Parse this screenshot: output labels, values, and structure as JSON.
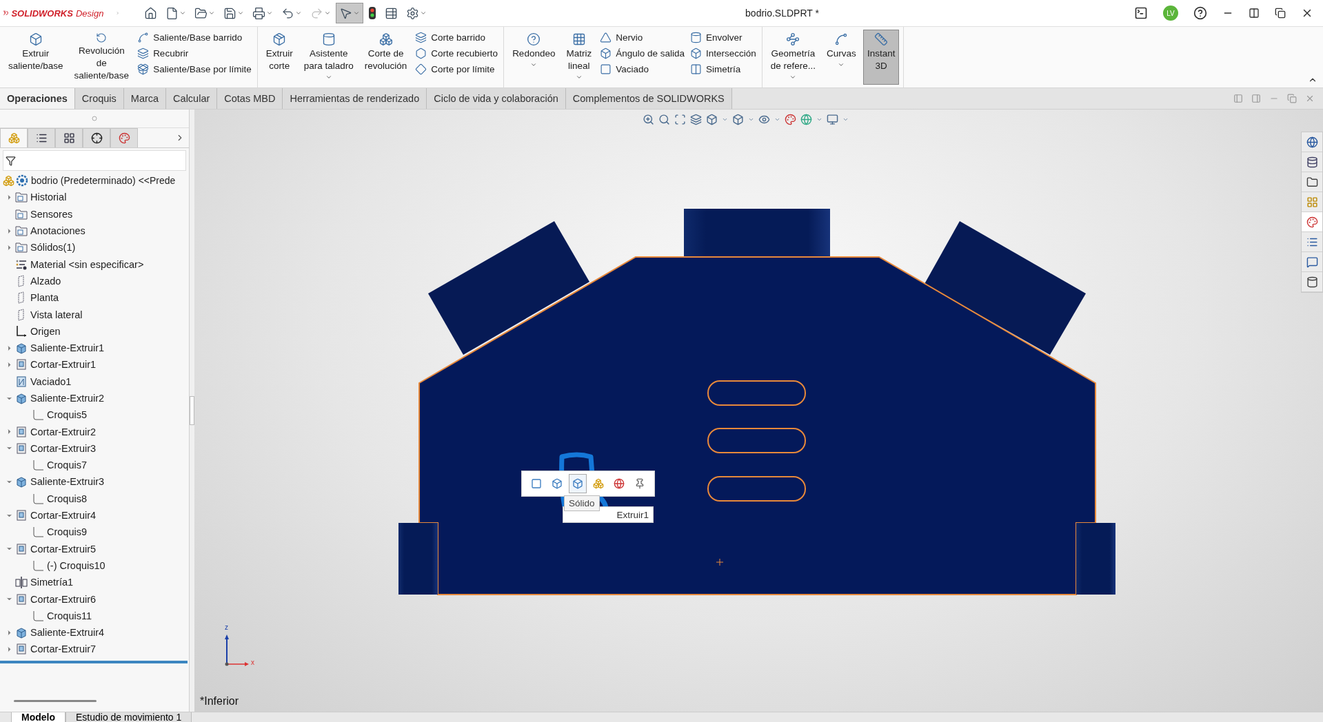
{
  "app": {
    "brand": "SOLIDWORKS",
    "product": "Design",
    "title": "bodrio.SLDPRT *",
    "user_initials": "LV"
  },
  "quick_access": [
    {
      "kind": "home",
      "dropdown": false,
      "selected": false
    },
    {
      "kind": "new",
      "dropdown": true,
      "selected": false
    },
    {
      "kind": "open",
      "dropdown": true,
      "selected": false
    },
    {
      "kind": "save",
      "dropdown": true,
      "selected": false
    },
    {
      "kind": "print",
      "dropdown": true,
      "selected": false
    },
    {
      "kind": "undo",
      "dropdown": true,
      "selected": false
    },
    {
      "kind": "redo",
      "dropdown": true,
      "selected": false
    },
    {
      "kind": "select",
      "dropdown": true,
      "selected": true
    },
    {
      "kind": "rebuild",
      "dropdown": false,
      "selected": false
    },
    {
      "kind": "properties",
      "dropdown": false,
      "selected": false
    },
    {
      "kind": "options",
      "dropdown": true,
      "selected": false
    }
  ],
  "ribbon": {
    "groups": [
      {
        "items": [
          {
            "kind": "large",
            "label": "Extruir\nsaliente/base",
            "dropdown": false,
            "selected": false
          },
          {
            "kind": "large",
            "label": "Revolución\nde\nsaliente/base",
            "dropdown": false,
            "selected": false
          },
          {
            "kind": "stack",
            "items": [
              {
                "label": "Saliente/Base barrido"
              },
              {
                "label": "Recubrir"
              },
              {
                "label": "Saliente/Base por límite"
              }
            ]
          }
        ]
      },
      {
        "items": [
          {
            "kind": "large",
            "label": "Extruir\ncorte",
            "dropdown": false,
            "selected": false
          },
          {
            "kind": "large",
            "label": "Asistente\npara taladro",
            "dropdown": true,
            "selected": false
          },
          {
            "kind": "large",
            "label": "Corte de\nrevolución",
            "dropdown": false,
            "selected": false
          },
          {
            "kind": "stack",
            "items": [
              {
                "label": "Corte barrido"
              },
              {
                "label": "Corte recubierto"
              },
              {
                "label": "Corte por límite"
              }
            ]
          }
        ]
      },
      {
        "items": [
          {
            "kind": "large",
            "label": "Redondeo",
            "dropdown": true,
            "selected": false
          },
          {
            "kind": "large",
            "label": "Matriz\nlineal",
            "dropdown": true,
            "selected": false
          },
          {
            "kind": "stack",
            "items": [
              {
                "label": "Nervio"
              },
              {
                "label": "Ángulo de salida"
              },
              {
                "label": "Vaciado"
              }
            ]
          },
          {
            "kind": "stack",
            "items": [
              {
                "label": "Envolver"
              },
              {
                "label": "Intersección"
              },
              {
                "label": "Simetría"
              }
            ]
          }
        ]
      },
      {
        "items": [
          {
            "kind": "large",
            "label": "Geometría\nde refere...",
            "dropdown": true,
            "selected": false
          },
          {
            "kind": "large",
            "label": "Curvas",
            "dropdown": true,
            "selected": false
          },
          {
            "kind": "large",
            "label": "Instant\n3D",
            "dropdown": false,
            "selected": true
          }
        ]
      }
    ]
  },
  "command_tabs": [
    {
      "label": "Operaciones",
      "selected": true
    },
    {
      "label": "Croquis",
      "selected": false
    },
    {
      "label": "Marca",
      "selected": false
    },
    {
      "label": "Calcular",
      "selected": false
    },
    {
      "label": "Cotas MBD",
      "selected": false
    },
    {
      "label": "Herramientas de renderizado",
      "selected": false
    },
    {
      "label": "Ciclo de vida y colaboración",
      "selected": false
    },
    {
      "label": "Complementos de SOLIDWORKS",
      "selected": false
    }
  ],
  "panel_tabs": [
    {
      "kind": "feature-manager",
      "selected": true
    },
    {
      "kind": "property-manager",
      "selected": false
    },
    {
      "kind": "configuration-manager",
      "selected": false
    },
    {
      "kind": "dimxpert",
      "selected": false
    },
    {
      "kind": "display-manager",
      "selected": false
    }
  ],
  "tree": {
    "root": {
      "label": "bodrio (Predeterminado) <<Prede"
    },
    "items": [
      {
        "label": "Historial",
        "kind": "history",
        "expandable": true,
        "expanded": false
      },
      {
        "label": "Sensores",
        "kind": "sensors",
        "expandable": false,
        "expanded": false
      },
      {
        "label": "Anotaciones",
        "kind": "annotations",
        "expandable": true,
        "expanded": false
      },
      {
        "label": "Sólidos(1)",
        "kind": "solids",
        "expandable": true,
        "expanded": false
      },
      {
        "label": "Material <sin especificar>",
        "kind": "material",
        "expandable": false,
        "expanded": false
      },
      {
        "label": "Alzado",
        "kind": "plane",
        "expandable": false,
        "expanded": false
      },
      {
        "label": "Planta",
        "kind": "plane",
        "expandable": false,
        "expanded": false
      },
      {
        "label": "Vista lateral",
        "kind": "plane",
        "expandable": false,
        "expanded": false
      },
      {
        "label": "Origen",
        "kind": "origin",
        "expandable": false,
        "expanded": false
      },
      {
        "label": "Saliente-Extruir1",
        "kind": "boss",
        "expandable": true,
        "expanded": false
      },
      {
        "label": "Cortar-Extruir1",
        "kind": "cut",
        "expandable": true,
        "expanded": false
      },
      {
        "label": "Vaciado1",
        "kind": "shell",
        "expandable": false,
        "expanded": false
      },
      {
        "label": "Saliente-Extruir2",
        "kind": "boss",
        "expandable": true,
        "expanded": true,
        "children": [
          {
            "label": "Croquis5",
            "kind": "sketch",
            "expandable": false,
            "expanded": false
          }
        ]
      },
      {
        "label": "Cortar-Extruir2",
        "kind": "cut",
        "expandable": true,
        "expanded": false
      },
      {
        "label": "Cortar-Extruir3",
        "kind": "cut",
        "expandable": true,
        "expanded": true,
        "children": [
          {
            "label": "Croquis7",
            "kind": "sketch",
            "expandable": false,
            "expanded": false
          }
        ]
      },
      {
        "label": "Saliente-Extruir3",
        "kind": "boss",
        "expandable": true,
        "expanded": true,
        "children": [
          {
            "label": "Croquis8",
            "kind": "sketch",
            "expandable": false,
            "expanded": false
          }
        ]
      },
      {
        "label": "Cortar-Extruir4",
        "kind": "cut",
        "expandable": true,
        "expanded": true,
        "children": [
          {
            "label": "Croquis9",
            "kind": "sketch",
            "expandable": false,
            "expanded": false
          }
        ]
      },
      {
        "label": "Cortar-Extruir5",
        "kind": "cut",
        "expandable": true,
        "expanded": true,
        "children": [
          {
            "label": "(-) Croquis10",
            "kind": "sketch",
            "expandable": false,
            "expanded": false
          }
        ]
      },
      {
        "label": "Simetría1",
        "kind": "mirror",
        "expandable": false,
        "expanded": false
      },
      {
        "label": "Cortar-Extruir6",
        "kind": "cut",
        "expandable": true,
        "expanded": true,
        "children": [
          {
            "label": "Croquis11",
            "kind": "sketch",
            "expandable": false,
            "expanded": false
          }
        ]
      },
      {
        "label": "Saliente-Extruir4",
        "kind": "boss",
        "expandable": true,
        "expanded": false
      },
      {
        "label": "Cortar-Extruir7",
        "kind": "cut",
        "expandable": true,
        "expanded": false
      }
    ]
  },
  "viewport": {
    "view_label": "*Inferior",
    "triad": {
      "vertical_label": "z",
      "horizontal_label": "x"
    },
    "context_toolbar": [
      {
        "kind": "face",
        "selected": false
      },
      {
        "kind": "feature",
        "selected": false
      },
      {
        "kind": "solid",
        "selected": true
      },
      {
        "kind": "part",
        "selected": false
      },
      {
        "kind": "appearance",
        "selected": false
      },
      {
        "kind": "pin",
        "selected": false
      }
    ],
    "hover_tooltip": "Sólido",
    "feature_tooltip": "Extruir1"
  },
  "bottom_tabs": [
    {
      "label": "Modelo",
      "selected": true
    },
    {
      "label": "Estudio de movimiento 1",
      "selected": false
    }
  ]
}
